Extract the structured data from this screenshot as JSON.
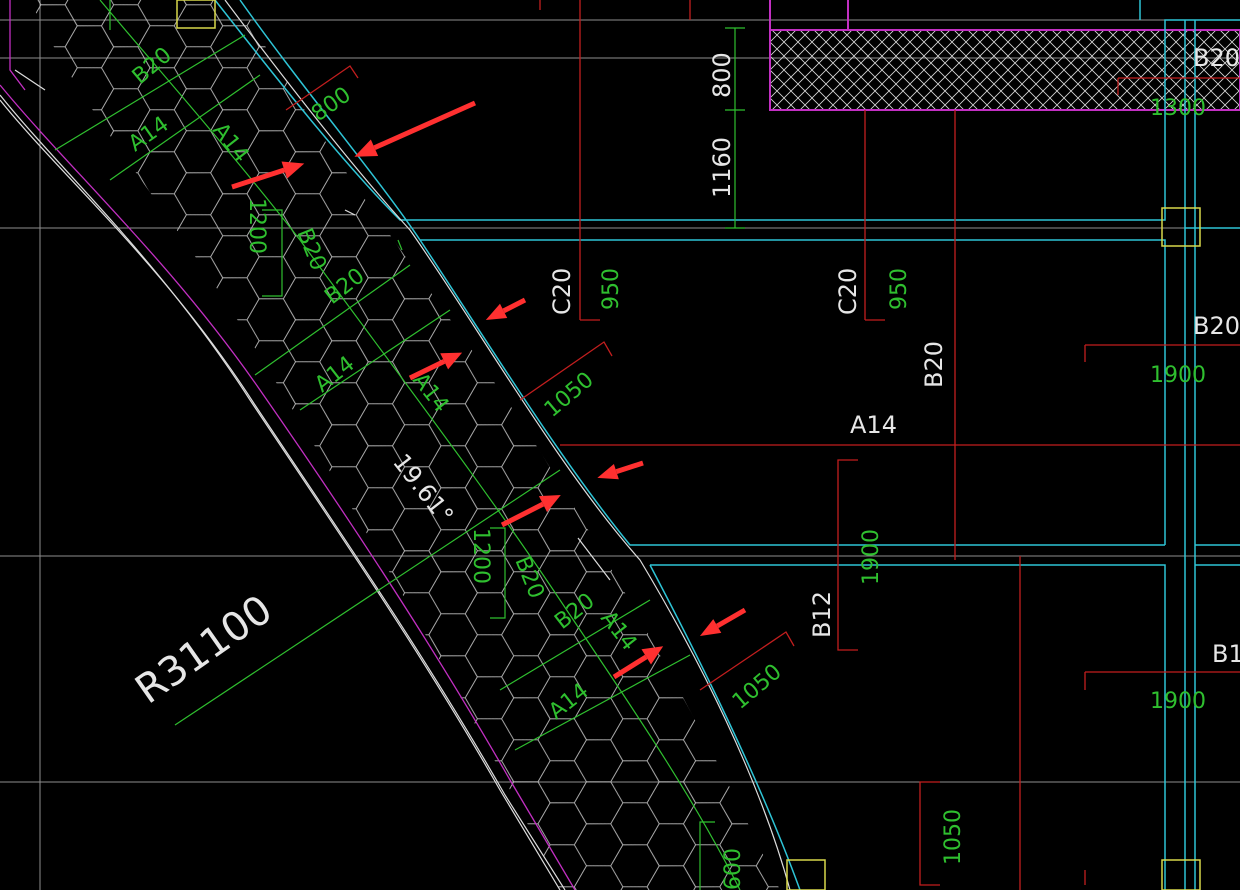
{
  "colors": {
    "background": "#000000",
    "cyan": "#2ec4d6",
    "green": "#2fbf2f",
    "red": "#c21e1e",
    "magenta": "#c22fc2",
    "white": "#e6e6e6",
    "grid": "#9a9a9a",
    "yellow": "#d8d84a",
    "arrow": "#ff3030"
  },
  "labels": {
    "b20_top_left": "B20",
    "a14_left_a": "A14",
    "a14_left_b": "A14",
    "dim_800_diag": "800",
    "dim_1200_upper": "1200",
    "b20_upper_v": "B20",
    "b20_upper_diag": "B20",
    "a14_mid_a": "A14",
    "a14_mid_b": "A14",
    "dim_1050_upper": "1050",
    "angle": "19.61°",
    "dim_1200_lower": "1200",
    "b20_lower_v": "B20",
    "b20_lower_diag": "B20",
    "a14_low_a": "A14",
    "a14_low_b": "A14",
    "dim_1050_lower": "1050",
    "radius": "R31100",
    "dim_600": "600",
    "dim_800_v": "800",
    "dim_1160": "1160",
    "c20_left": "C20",
    "dim_950_left": "950",
    "c20_right": "C20",
    "dim_950_right": "950",
    "b20_center": "B20",
    "a14_center": "A14",
    "dim_1900_center": "1900",
    "b12": "B12",
    "dim_1050_bottom": "1050",
    "b20_right_top": "B20",
    "dim_1300": "1300",
    "b20_right_mid": "B20",
    "dim_1900_right_a": "1900",
    "b1_right": "B1",
    "dim_1900_right_b": "1900"
  },
  "icons": {
    "annotation_arrow": "red-arrow-icon",
    "column": "column-square-icon"
  }
}
